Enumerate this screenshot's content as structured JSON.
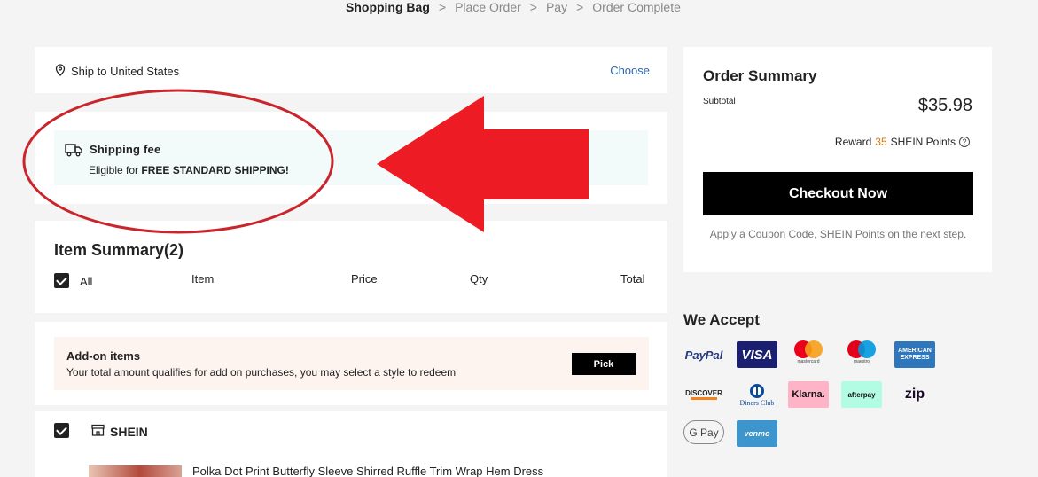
{
  "steps": {
    "current": "Shopping Bag",
    "sep": ">",
    "place_order": "Place Order",
    "pay": "Pay",
    "complete": "Order Complete"
  },
  "shipping": {
    "location": "Ship to United States",
    "choose": "Choose"
  },
  "fee": {
    "title": "Shipping fee",
    "prefix": "Eligible for ",
    "bold": "FREE STANDARD SHIPPING!"
  },
  "items": {
    "title": "Item Summary(2)",
    "all": "All",
    "col_item": "Item",
    "col_price": "Price",
    "col_qty": "Qty",
    "col_total": "Total"
  },
  "addon": {
    "title": "Add-on items",
    "subtitle": "Your total amount qualifies for add on purchases, you may select a style to redeem",
    "pick": "Pick"
  },
  "shop": {
    "name": "SHEIN",
    "product_title": "Polka Dot Print Butterfly Sleeve Shirred Ruffle Trim Wrap Hem Dress"
  },
  "summary": {
    "title": "Order Summary",
    "subtotal_label": "Subtotal",
    "subtotal_value": "$35.98",
    "reward_prefix": "Reward",
    "reward_points": "35",
    "reward_suffix": "SHEIN Points",
    "help": "?",
    "checkout": "Checkout Now",
    "coupon_note": "Apply a Coupon Code, SHEIN Points on the next step."
  },
  "accept": {
    "title": "We Accept",
    "methods": {
      "paypal": "PayPal",
      "visa": "VISA",
      "mastercard": "mastercard",
      "maestro": "maestro",
      "amex_top": "AMERICAN",
      "amex_bottom": "EXPRESS",
      "discover": "DISCOVER",
      "diners": "Diners Club",
      "klarna": "Klarna.",
      "afterpay": "afterpay",
      "zip": "zip",
      "gpay": "G Pay",
      "venmo": "venmo"
    }
  },
  "colors": {
    "annotation_red": "#e8202a",
    "link_blue": "#2d68a8",
    "points_orange": "#c97b1a"
  }
}
